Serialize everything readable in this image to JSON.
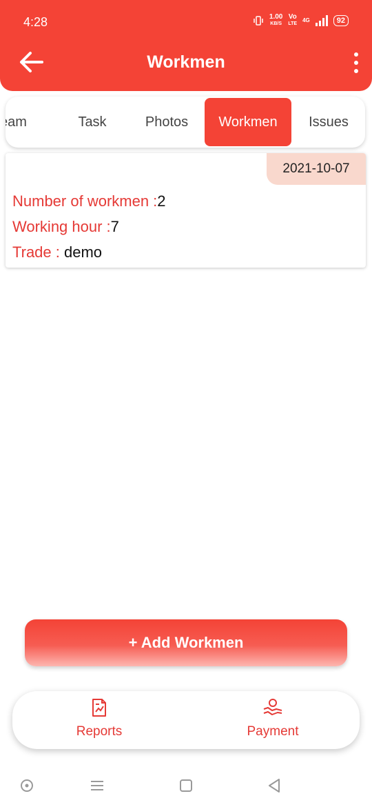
{
  "status_bar": {
    "time": "4:28",
    "net_speed": "1.00",
    "net_unit": "KB/S",
    "carrier": "Vo",
    "carrier_sub": "LTE",
    "network": "4G",
    "battery": "92"
  },
  "app_bar": {
    "title": "Workmen",
    "back_icon": "arrow-left-icon",
    "more_icon": "more-vertical-icon"
  },
  "tabs": [
    {
      "label": "Team",
      "visible": "eam"
    },
    {
      "label": "Task"
    },
    {
      "label": "Photos"
    },
    {
      "label": "Workmen",
      "active": true
    },
    {
      "label": "Issues"
    }
  ],
  "entry": {
    "date": "2021-10-07",
    "workmen_label": "Number of workmen :",
    "workmen_value": "2",
    "hours_label": "Working hour :",
    "hours_value": "7",
    "trade_label": "Trade : ",
    "trade_value": "demo"
  },
  "add_button": {
    "label": "+ Add Workmen"
  },
  "bottom_nav": [
    {
      "label": "Reports",
      "icon": "report-chart-icon"
    },
    {
      "label": "Payment",
      "icon": "handshake-payment-icon"
    }
  ],
  "colors": {
    "primary": "#f44336",
    "label_red": "#e53935",
    "date_chip": "#f9d8cd"
  }
}
